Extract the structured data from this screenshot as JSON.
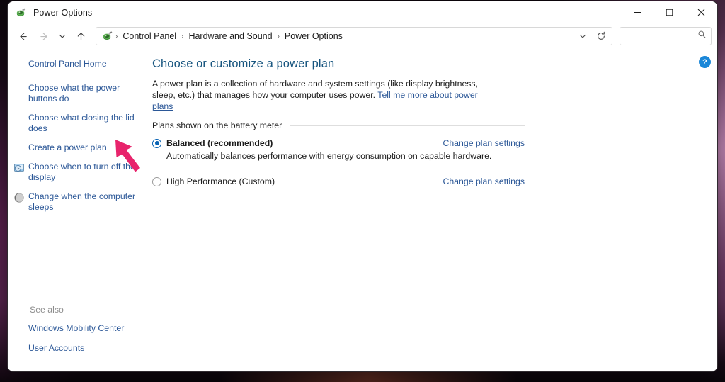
{
  "window": {
    "title": "Power Options",
    "title_icon": "power-options-icon",
    "controls": {
      "minimize": "minimize-icon",
      "maximize": "maximize-icon",
      "close": "close-icon"
    }
  },
  "addressbar": {
    "back": "back-arrow-icon",
    "forward": "forward-arrow-icon",
    "recent": "chevron-down-icon",
    "up": "up-arrow-icon",
    "crumb_icon": "power-options-icon",
    "breadcrumbs": [
      "Control Panel",
      "Hardware and Sound",
      "Power Options"
    ],
    "separator": "›",
    "dropdown": "chevron-down-icon",
    "refresh": "refresh-icon",
    "search": {
      "value": "",
      "placeholder": "",
      "icon": "search-icon"
    }
  },
  "sidebar": {
    "items": [
      {
        "label": "Control Panel Home",
        "icon": ""
      },
      {
        "label": "Choose what the power buttons do",
        "icon": ""
      },
      {
        "label": "Choose what closing the lid does",
        "icon": ""
      },
      {
        "label": "Create a power plan",
        "icon": ""
      },
      {
        "label": "Choose when to turn off the display",
        "icon": "display-clock-icon"
      },
      {
        "label": "Change when the computer sleeps",
        "icon": "sleep-moon-icon"
      }
    ],
    "see_also_label": "See also",
    "see_also": [
      {
        "label": "Windows Mobility Center"
      },
      {
        "label": "User Accounts"
      }
    ]
  },
  "content": {
    "title": "Choose or customize a power plan",
    "description_part1": "A power plan is a collection of hardware and system settings (like display brightness, sleep, etc.) that manages how your computer uses power. ",
    "description_link": "Tell me more about power plans",
    "group_label": "Plans shown on the battery meter",
    "plans": [
      {
        "name": "Balanced (recommended)",
        "selected": true,
        "description": "Automatically balances performance with energy consumption on capable hardware.",
        "change_link": "Change plan settings"
      },
      {
        "name": "High Performance (Custom)",
        "selected": false,
        "description": "",
        "change_link": "Change plan settings"
      }
    ],
    "help_button": "?"
  },
  "annotation": {
    "arrow": "red-arrow-annotation",
    "color": "#e8246c"
  },
  "colors": {
    "link": "#2b5797",
    "title": "#17557f",
    "accent_radio": "#0a64b4",
    "help_blue": "#1b87d8",
    "arrow_red": "#e8246c"
  }
}
